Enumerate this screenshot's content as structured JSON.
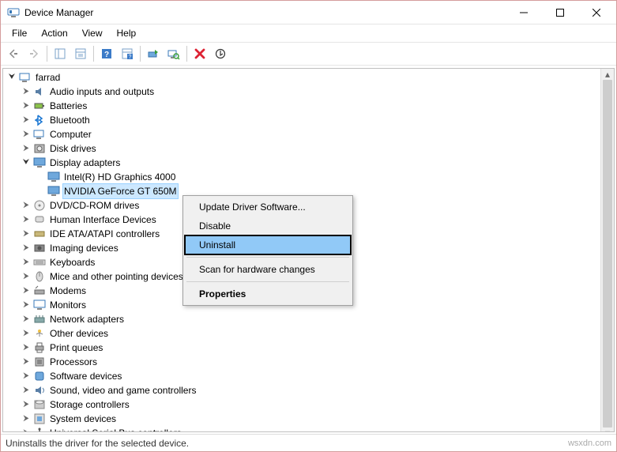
{
  "title": "Device Manager",
  "menu": {
    "file": "File",
    "action": "Action",
    "view": "View",
    "help": "Help"
  },
  "root": "farrad",
  "tree": [
    {
      "label": "Audio inputs and outputs",
      "expanded": false,
      "icon": "audio"
    },
    {
      "label": "Batteries",
      "expanded": false,
      "icon": "battery"
    },
    {
      "label": "Bluetooth",
      "expanded": false,
      "icon": "bluetooth"
    },
    {
      "label": "Computer",
      "expanded": false,
      "icon": "computer"
    },
    {
      "label": "Disk drives",
      "expanded": false,
      "icon": "disk"
    },
    {
      "label": "Display adapters",
      "expanded": true,
      "icon": "display",
      "children": [
        {
          "label": "Intel(R) HD Graphics 4000",
          "icon": "display"
        },
        {
          "label": "NVIDIA GeForce GT 650M",
          "icon": "display",
          "selected": true
        }
      ]
    },
    {
      "label": "DVD/CD-ROM drives",
      "expanded": false,
      "icon": "dvd"
    },
    {
      "label": "Human Interface Devices",
      "expanded": false,
      "icon": "hid"
    },
    {
      "label": "IDE ATA/ATAPI controllers",
      "expanded": false,
      "icon": "ide"
    },
    {
      "label": "Imaging devices",
      "expanded": false,
      "icon": "imaging"
    },
    {
      "label": "Keyboards",
      "expanded": false,
      "icon": "keyboard"
    },
    {
      "label": "Mice and other pointing devices",
      "expanded": false,
      "icon": "mouse"
    },
    {
      "label": "Modems",
      "expanded": false,
      "icon": "modem"
    },
    {
      "label": "Monitors",
      "expanded": false,
      "icon": "monitor"
    },
    {
      "label": "Network adapters",
      "expanded": false,
      "icon": "network"
    },
    {
      "label": "Other devices",
      "expanded": false,
      "icon": "other"
    },
    {
      "label": "Print queues",
      "expanded": false,
      "icon": "print"
    },
    {
      "label": "Processors",
      "expanded": false,
      "icon": "cpu"
    },
    {
      "label": "Software devices",
      "expanded": false,
      "icon": "software"
    },
    {
      "label": "Sound, video and game controllers",
      "expanded": false,
      "icon": "sound"
    },
    {
      "label": "Storage controllers",
      "expanded": false,
      "icon": "storage"
    },
    {
      "label": "System devices",
      "expanded": false,
      "icon": "system"
    },
    {
      "label": "Universal Serial Bus controllers",
      "expanded": false,
      "icon": "usb"
    }
  ],
  "context_menu": [
    {
      "label": "Update Driver Software...",
      "type": "item"
    },
    {
      "label": "Disable",
      "type": "item"
    },
    {
      "label": "Uninstall",
      "type": "item",
      "highlighted": true,
      "boxed": true
    },
    {
      "type": "sep"
    },
    {
      "label": "Scan for hardware changes",
      "type": "item"
    },
    {
      "type": "sep"
    },
    {
      "label": "Properties",
      "type": "item",
      "bold": true
    }
  ],
  "status": "Uninstalls the driver for the selected device.",
  "watermark": "wsxdn.com"
}
